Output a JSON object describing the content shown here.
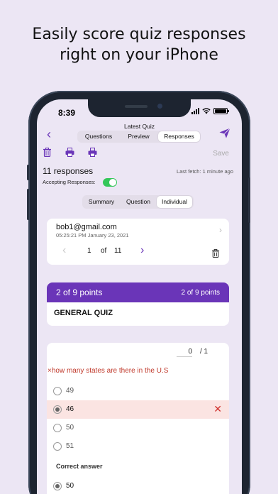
{
  "headline": [
    "Easily score quiz responses",
    "right on your iPhone"
  ],
  "status": {
    "time": "8:39"
  },
  "nav": {
    "title": "Latest Quiz",
    "tabs": [
      {
        "label": "Questions",
        "active": false
      },
      {
        "label": "Preview",
        "active": false
      },
      {
        "label": "Responses",
        "active": true
      }
    ]
  },
  "toolbar": {
    "icons": [
      "trash-icon",
      "print-icon",
      "print-icon"
    ],
    "save_label": "Save"
  },
  "summary": {
    "responses": "11 responses",
    "last_fetch": "Last fetch: 1 minute ago",
    "accepting_label": "Accepting Responses:",
    "accepting_on": true
  },
  "view_tabs": [
    {
      "label": "Summary",
      "active": false
    },
    {
      "label": "Question",
      "active": false
    },
    {
      "label": "Individual",
      "active": true
    }
  ],
  "respondent": {
    "email": "bob1@gmail.com",
    "timestamp": "05:25:21 PM  January 23, 2021",
    "page_current": "1",
    "page_of": "of",
    "page_total": "11"
  },
  "score": {
    "left": "2 of 9 points",
    "right": "2 of 9 points",
    "quiz_title": "GENERAL QUIZ"
  },
  "question": {
    "points_value": "0",
    "points_total": "/ 1",
    "text": "×how many states are there in the U.S",
    "options": [
      {
        "label": "49",
        "selected": false
      },
      {
        "label": "46",
        "selected": true,
        "wrong": true
      },
      {
        "label": "50",
        "selected": false
      },
      {
        "label": "51",
        "selected": false
      }
    ],
    "correct_label": "Correct answer",
    "correct_option": "50"
  },
  "colors": {
    "accent": "#6a35b8",
    "background": "#ece6f4",
    "error": "#c0392b",
    "toggle": "#34c759"
  }
}
